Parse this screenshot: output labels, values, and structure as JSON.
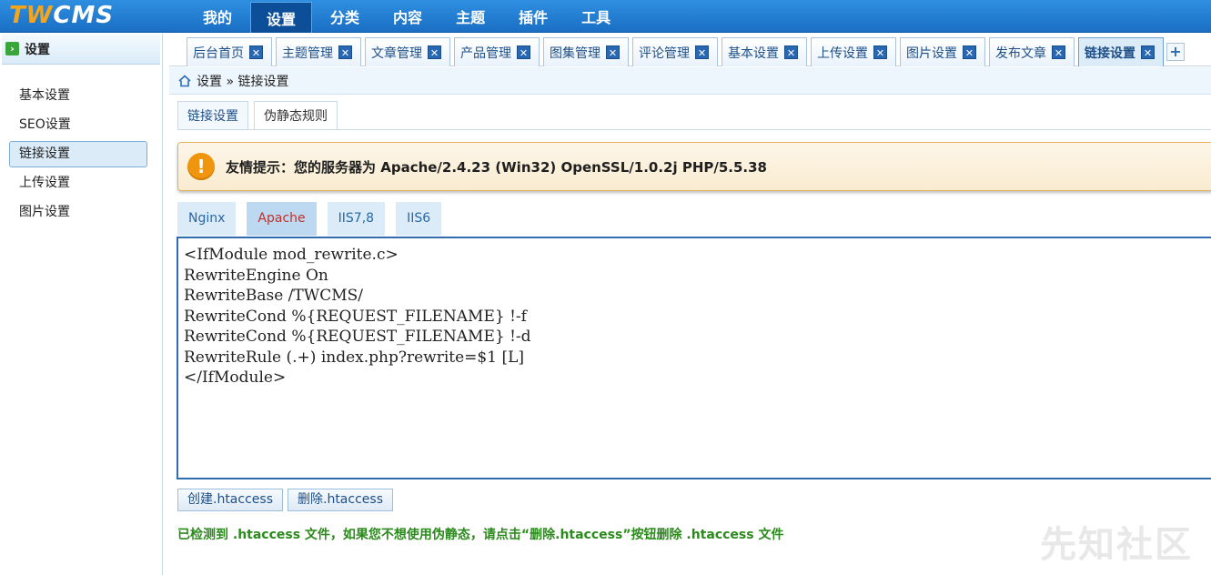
{
  "logo": {
    "part1": "TW",
    "part2": "CMS"
  },
  "topnav": [
    "我的",
    "设置",
    "分类",
    "内容",
    "主题",
    "插件",
    "工具"
  ],
  "topnav_active": 1,
  "sidebar": {
    "title": "设置",
    "items": [
      "基本设置",
      "SEO设置",
      "链接设置",
      "上传设置",
      "图片设置"
    ],
    "active": 2
  },
  "tabs": [
    "后台首页",
    "主题管理",
    "文章管理",
    "产品管理",
    "图集管理",
    "评论管理",
    "基本设置",
    "上传设置",
    "图片设置",
    "发布文章",
    "链接设置"
  ],
  "tab_close_glyph": "✕",
  "tab_add_glyph": "+",
  "breadcrumb": "设置 » 链接设置",
  "subtabs": [
    "链接设置",
    "伪静态规则"
  ],
  "alert": {
    "text": "友情提示：您的服务器为 Apache/2.4.23 (Win32) OpenSSL/1.0.2j PHP/5.5.38",
    "icon_glyph": "!"
  },
  "server_tabs": [
    "Nginx",
    "Apache",
    "IIS7,8",
    "IIS6"
  ],
  "server_active": 1,
  "code": "<IfModule mod_rewrite.c>\nRewriteEngine On\nRewriteBase /TWCMS/\nRewriteCond %{REQUEST_FILENAME} !-f\nRewriteCond %{REQUEST_FILENAME} !-d\nRewriteRule (.+) index.php?rewrite=$1 [L]\n</IfModule>",
  "buttons": {
    "create": "创建.htaccess",
    "delete": "删除.htaccess"
  },
  "notice": "已检测到 .htaccess 文件，如果您不想使用伪静态，请点击“删除.htaccess”按钮删除 .htaccess 文件",
  "watermark": "先知社区",
  "colors": {
    "topbar": "#1f7bd0",
    "accent_orange": "#f0960e",
    "notice_green": "#2b8a1c",
    "active_server_tab_text": "#c0312b"
  }
}
